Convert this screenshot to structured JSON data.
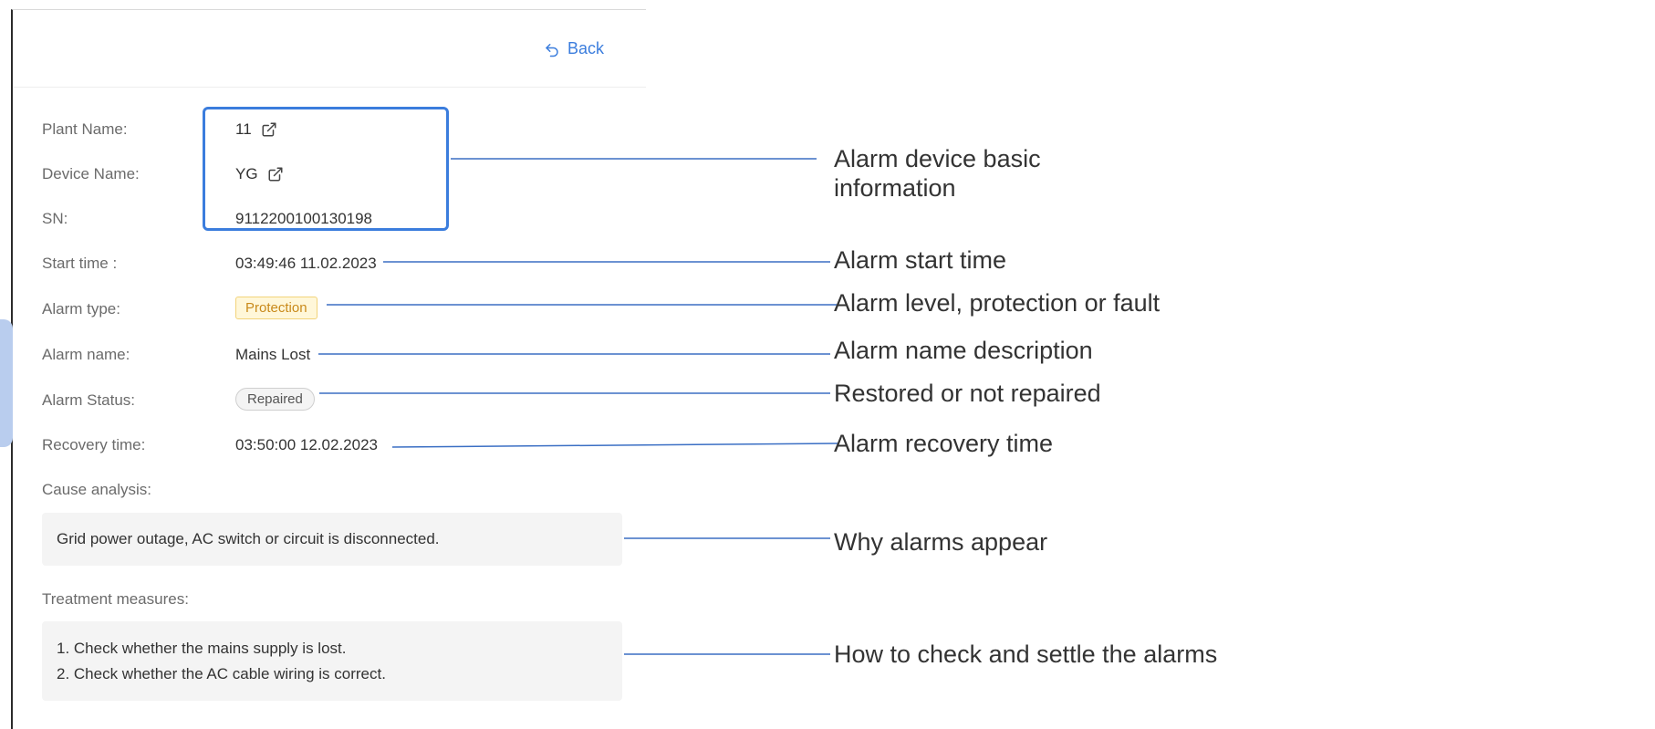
{
  "header": {
    "back_label": "Back"
  },
  "fields": {
    "plant_name_label": "Plant Name:",
    "plant_name_value": "11",
    "device_name_label": "Device Name:",
    "device_name_value": "YG",
    "sn_label": "SN:",
    "sn_value": "9112200100130198",
    "start_time_label": "Start time :",
    "start_time_value": "03:49:46 11.02.2023",
    "alarm_type_label": "Alarm type:",
    "alarm_type_value": "Protection",
    "alarm_name_label": "Alarm name:",
    "alarm_name_value": "Mains Lost",
    "alarm_status_label": "Alarm Status:",
    "alarm_status_value": "Repaired",
    "recovery_time_label": "Recovery time:",
    "recovery_time_value": "03:50:00 12.02.2023",
    "cause_analysis_label": "Cause analysis:",
    "cause_analysis_value": "Grid power outage, AC switch or circuit is disconnected.",
    "treatment_label": "Treatment measures:",
    "treatment_items": [
      "1. Check whether the mains supply is lost.",
      "2. Check whether the AC cable wiring is correct."
    ]
  },
  "callouts": {
    "basic_info_line1": "Alarm device basic",
    "basic_info_line2": "information",
    "start_time": "Alarm start time",
    "alarm_level": "Alarm level, protection or fault",
    "alarm_name": "Alarm name description",
    "status": "Restored or not repaired",
    "recovery_time": "Alarm recovery time",
    "why": "Why alarms appear",
    "how": "How to check and settle the alarms"
  },
  "colors": {
    "accent": "#3b7ddd",
    "protection_tag_bg": "#fff7d9",
    "protection_tag_text": "#c98a1b"
  }
}
